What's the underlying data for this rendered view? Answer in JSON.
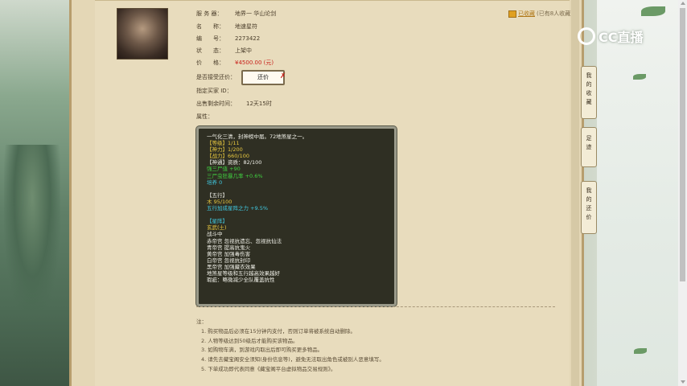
{
  "header": {
    "server_label": "服 务 器：",
    "server_value": "地界一 华山论剑"
  },
  "favorite": {
    "link": "已收藏",
    "count": "(已有8人收藏)"
  },
  "details": [
    {
      "label": "名　　称：",
      "value": "地速星符"
    },
    {
      "label": "编　　号：",
      "value": "2273422"
    },
    {
      "label": "状　　态：",
      "value": "上架中"
    }
  ],
  "price": {
    "label": "价　　格：",
    "value": "¥4500.00 (元)"
  },
  "bargain": {
    "label": "是否接受还价：",
    "button": "还价",
    "x": "✗"
  },
  "buyer": {
    "label": "指定买家 ID："
  },
  "remaining": {
    "label": "出售剩余时间：",
    "value": "12天15时"
  },
  "attrs": {
    "label": "属性："
  },
  "tooltip": [
    {
      "t": "一气化三清，封神榜中届。72地煞星之一。",
      "c": "white"
    },
    {
      "t": "【等级】1/11",
      "c": "yellow"
    },
    {
      "t": "【神力】1/200",
      "c": "yellow"
    },
    {
      "t": "【战力】660/100",
      "c": "yellow"
    },
    {
      "t": "【神通】资质：82/100",
      "c": "white"
    },
    {
      "t": "强三尸值 +90",
      "c": "green"
    },
    {
      "t": "三尸虫狂暴几率 +0.6%",
      "c": "green"
    },
    {
      "t": "培养 0",
      "c": "cyan"
    },
    {
      "t": "",
      "c": "white"
    },
    {
      "t": "【五行】",
      "c": "white"
    },
    {
      "t": "木 95/100",
      "c": "yellow"
    },
    {
      "t": "五行加成星阵之力 +9.5%",
      "c": "cyan"
    },
    {
      "t": "",
      "c": "white"
    },
    {
      "t": "【星阵】",
      "c": "cyan"
    },
    {
      "t": "玄武(土)",
      "c": "yellow"
    },
    {
      "t": "战斗中",
      "c": "white"
    },
    {
      "t": "赤帝宫 忽视抗遗忘、忽视抗仙法",
      "c": "white"
    },
    {
      "t": "青帝宫 提高抗鬼火",
      "c": "white"
    },
    {
      "t": "黄帝宫 加强毒伤害",
      "c": "white"
    },
    {
      "t": "白帝宫 忽视抗封印",
      "c": "white"
    },
    {
      "t": "黑帝宫 加强藏衣效果",
      "c": "white"
    },
    {
      "t": "地煞星等级和五行越高效果越好",
      "c": "white"
    },
    {
      "t": "瑕疵：略微减少全队覆盖抗性",
      "c": "white"
    }
  ],
  "notes": {
    "title": "注：",
    "lines": [
      "1. 购买物品后必须在15分钟内支付，否则订单将被系统自动删除。",
      "2. 人物等级达到50级后才能购买该物品。",
      "3. 如购物车满，到游戏内取出后即可购买更多物品。",
      "4. 请先去藏宝阁安全须知(身份信息等)，避免无法取出角色或被别人恶意填写。",
      "5. 下单成功即代表同意《藏宝阁平台虚拟物品交易规则》。"
    ]
  },
  "sidebar": {
    "tab1": "我的收藏",
    "tab2": "足迹",
    "tab3": "我的还价"
  },
  "logo": {
    "text": "CC直播"
  }
}
